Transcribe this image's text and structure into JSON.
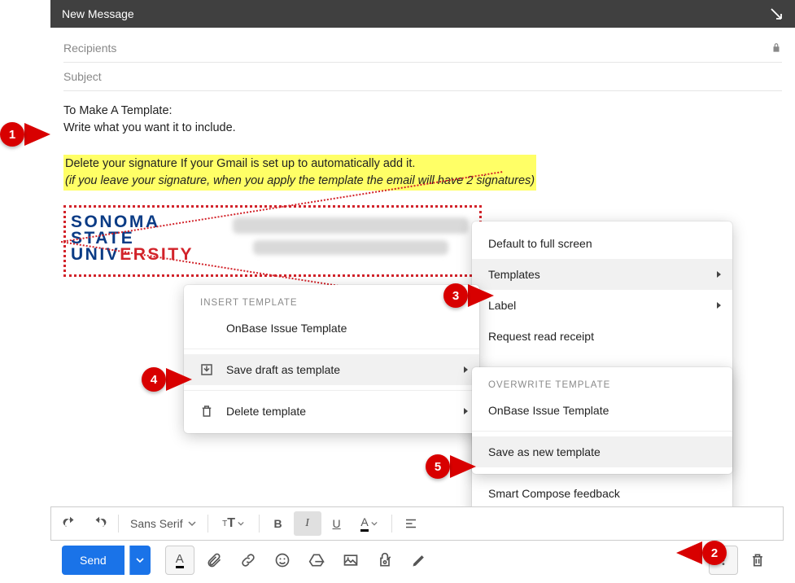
{
  "window": {
    "title": "New Message"
  },
  "fields": {
    "recipients_placeholder": "Recipients",
    "subject_placeholder": "Subject"
  },
  "body": {
    "line1": "To Make A Template:",
    "line2": "Write what you want it to include.",
    "highlight_line1": "Delete your signature If your Gmail is set up to automatically add it.",
    "highlight_line2": "(if you leave your signature, when you apply the template the email will have 2 signatures)",
    "sig_logo_line1": "SONOMA",
    "sig_logo_line2": "STATE",
    "sig_logo_line3_a": "UNIV",
    "sig_logo_line3_b": "ERSITY"
  },
  "menu_main": {
    "default_fullscreen": "Default to full screen",
    "templates": "Templates",
    "label": "Label",
    "request_read_receipt": "Request read receipt",
    "smart_compose": "Smart Compose feedback"
  },
  "menu_templates": {
    "header_insert": "Insert template",
    "item_onbase": "OnBase Issue Template",
    "save_draft": "Save draft as template",
    "delete_template": "Delete template"
  },
  "menu_save": {
    "header": "Overwrite Template",
    "onbase": "OnBase Issue Template",
    "save_new": "Save as new template"
  },
  "format": {
    "font": "Sans Serif"
  },
  "toolbar": {
    "send": "Send"
  },
  "callouts": {
    "c1": "1",
    "c2": "2",
    "c3": "3",
    "c4": "4",
    "c5": "5"
  },
  "icons": {
    "lock": "lock",
    "expand": "expand"
  },
  "colors": {
    "accent": "#1a73e8",
    "callout": "#d80000",
    "highlight": "#ffff66"
  }
}
